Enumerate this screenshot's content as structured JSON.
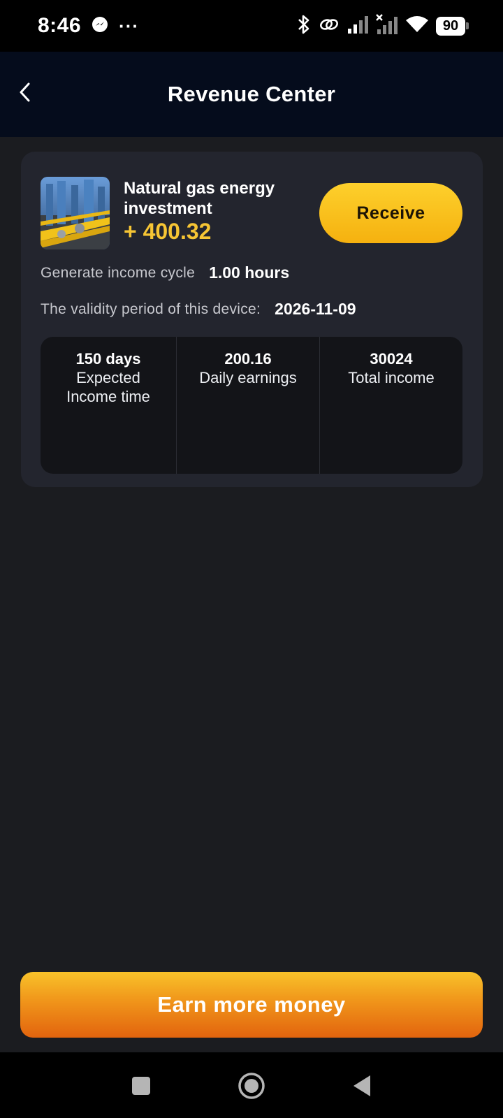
{
  "status_bar": {
    "time": "8:46",
    "overflow": "···",
    "battery": "90"
  },
  "header": {
    "title": "Revenue Center"
  },
  "card": {
    "product_name": "Natural gas energy investment",
    "amount": "+ 400.32",
    "receive_label": "Receive",
    "cycle_label": "Generate income cycle",
    "cycle_value": "1.00 hours",
    "validity_label": "The validity period of this device:",
    "validity_value": "2026-11-09",
    "stats": [
      {
        "value": "150 days",
        "label_line1": "Expected",
        "label_line2": "Income time"
      },
      {
        "value": "200.16",
        "label_line1": "Daily earnings",
        "label_line2": ""
      },
      {
        "value": "30024",
        "label_line1": "Total income",
        "label_line2": ""
      }
    ]
  },
  "footer": {
    "earn_label": "Earn more money"
  },
  "colors": {
    "accent_yellow": "#f6c534",
    "button_yellow": "#fdd02c",
    "button_orange": "#e2640e",
    "header_bg": "#050c1c",
    "card_bg": "#23252e"
  },
  "icons": {
    "back": "chevron-left-icon",
    "messenger": "messenger-icon",
    "bluetooth": "bluetooth-icon",
    "link": "link-icon",
    "signal": "signal-icon",
    "wifi": "wifi-icon",
    "nav_recent": "square-icon",
    "nav_home": "circle-icon",
    "nav_back": "triangle-back-icon"
  }
}
